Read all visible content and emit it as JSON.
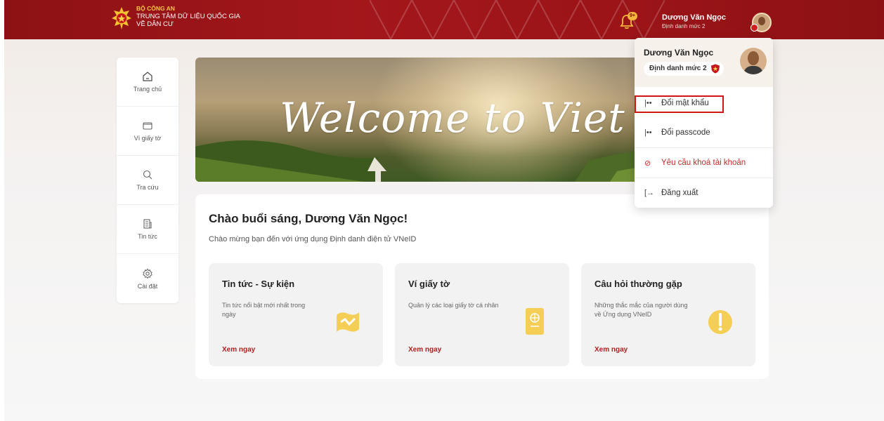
{
  "header": {
    "brand_line1": "BỘ CÔNG AN",
    "brand_line2": "TRUNG TÂM DỮ LIỆU QUỐC GIA",
    "brand_line3": "VỀ DÂN CƯ",
    "notification_badge": "9+",
    "user_name": "Dương Văn Ngọc",
    "user_level": "Định danh mức 2"
  },
  "sidebar": {
    "items": [
      {
        "label": "Trang chủ",
        "icon": "home-icon"
      },
      {
        "label": "Ví giấy tờ",
        "icon": "wallet-icon"
      },
      {
        "label": "Tra cứu",
        "icon": "search-icon"
      },
      {
        "label": "Tin tức",
        "icon": "news-icon"
      },
      {
        "label": "Cài đặt",
        "icon": "settings-icon"
      }
    ]
  },
  "banner": {
    "title": "Welcome to Viet N"
  },
  "welcome": {
    "greeting": "Chào buổi sáng, Dương Văn Ngọc!",
    "subtitle": "Chào mừng bạn đến với ứng dụng Định danh điện tử VNeID",
    "cards": [
      {
        "title": "Tin tức - Sự kiện",
        "desc": "Tin tức nổi bật mới nhất trong ngày",
        "link": "Xem ngay",
        "icon": "news-card-icon"
      },
      {
        "title": "Ví giấy tờ",
        "desc": "Quản lý các loại giấy tờ cá nhân",
        "link": "Xem ngay",
        "icon": "passport-card-icon"
      },
      {
        "title": "Câu hỏi thường gặp",
        "desc": "Những thắc mắc của người dùng về Ứng dụng VNeID",
        "link": "Xem ngay",
        "icon": "faq-card-icon"
      }
    ]
  },
  "account_menu": {
    "name": "Dương Văn Ngọc",
    "level": "Định danh mức 2",
    "change_password": "Đổi mật khẩu",
    "change_passcode": "Đổi passcode",
    "lock_account": "Yêu cầu khoá tài khoản",
    "logout": "Đăng xuất"
  },
  "colors": {
    "header_red": "#9b1418",
    "accent_red": "#b21f1f",
    "gold": "#f6c64a"
  }
}
